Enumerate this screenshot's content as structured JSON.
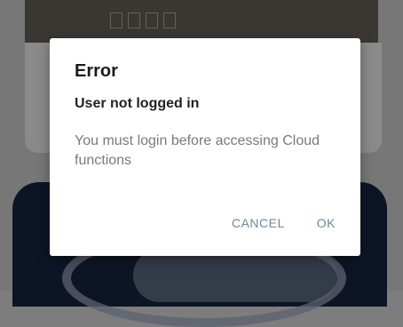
{
  "dialog": {
    "title": "Error",
    "subtitle": "User not logged in",
    "message": "You must login before accessing Cloud functions",
    "cancel_label": "CANCEL",
    "ok_label": "OK"
  },
  "colors": {
    "scrim": "#7d7d7d",
    "dialog_bg": "#ffffff",
    "button_text": "#6c8a99",
    "message_text": "#7a7a7a"
  }
}
